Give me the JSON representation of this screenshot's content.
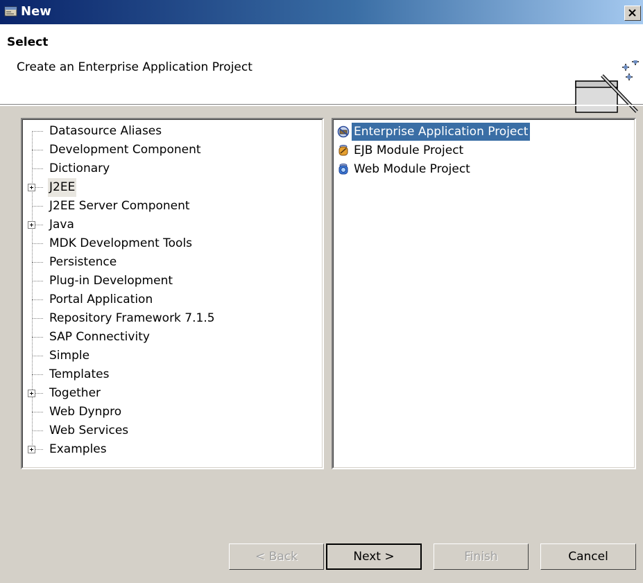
{
  "window": {
    "title": "New"
  },
  "header": {
    "title": "Select",
    "description": "Create an Enterprise Application Project"
  },
  "wizards": [
    {
      "label": "Datasource Aliases",
      "expandable": false
    },
    {
      "label": "Development Component",
      "expandable": false
    },
    {
      "label": "Dictionary",
      "expandable": false
    },
    {
      "label": "J2EE",
      "expandable": true,
      "selected": true
    },
    {
      "label": "J2EE Server Component",
      "expandable": false
    },
    {
      "label": "Java",
      "expandable": true
    },
    {
      "label": "MDK Development Tools",
      "expandable": false
    },
    {
      "label": "Persistence",
      "expandable": false
    },
    {
      "label": "Plug-in Development",
      "expandable": false
    },
    {
      "label": "Portal Application",
      "expandable": false
    },
    {
      "label": "Repository Framework 7.1.5",
      "expandable": false
    },
    {
      "label": "SAP Connectivity",
      "expandable": false
    },
    {
      "label": "Simple",
      "expandable": false
    },
    {
      "label": "Templates",
      "expandable": false
    },
    {
      "label": "Together",
      "expandable": true
    },
    {
      "label": "Web Dynpro",
      "expandable": false
    },
    {
      "label": "Web Services",
      "expandable": false
    },
    {
      "label": "Examples",
      "expandable": true
    }
  ],
  "projects": [
    {
      "label": "Enterprise Application Project",
      "icon": "enterprise-application-icon",
      "selected": true
    },
    {
      "label": "EJB Module Project",
      "icon": "ejb-module-icon"
    },
    {
      "label": "Web Module Project",
      "icon": "web-module-icon"
    }
  ],
  "buttons": {
    "back": "< Back",
    "next": "Next >",
    "finish": "Finish",
    "cancel": "Cancel"
  }
}
